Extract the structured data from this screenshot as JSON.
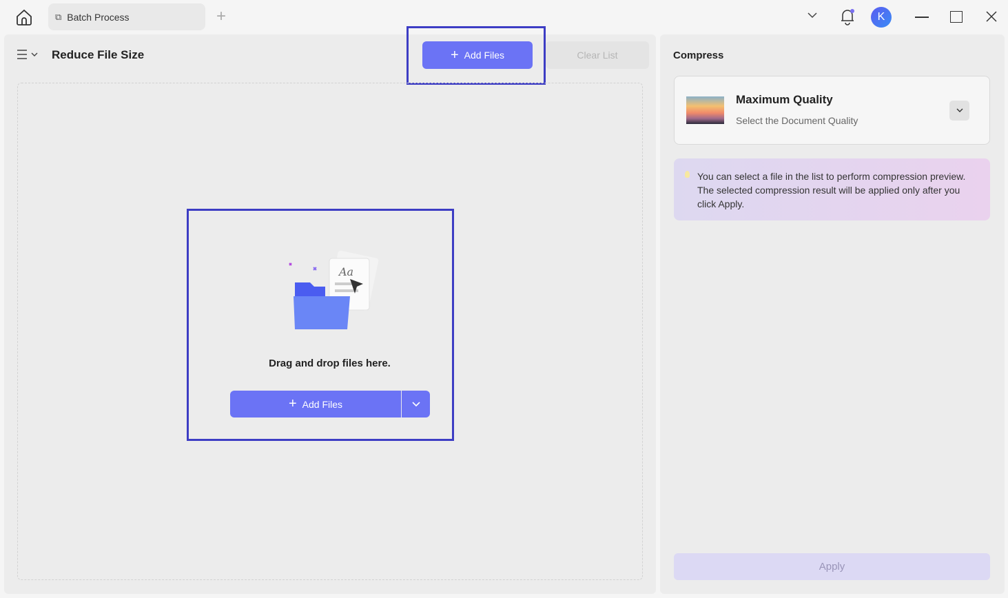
{
  "tabs": {
    "batch_label": "Batch Process"
  },
  "header": {
    "title": "Reduce File Size",
    "add_files": "Add Files",
    "clear_list": "Clear List"
  },
  "avatar": {
    "initial": "K"
  },
  "dropzone": {
    "text": "Drag and drop files here.",
    "add_files": "Add Files"
  },
  "compress": {
    "heading": "Compress",
    "quality_title": "Maximum Quality",
    "quality_sub": "Select the Document Quality",
    "tip": "You can select a file in the list to perform compression preview. The selected compression result will be applied only after you click Apply.",
    "apply": "Apply"
  }
}
